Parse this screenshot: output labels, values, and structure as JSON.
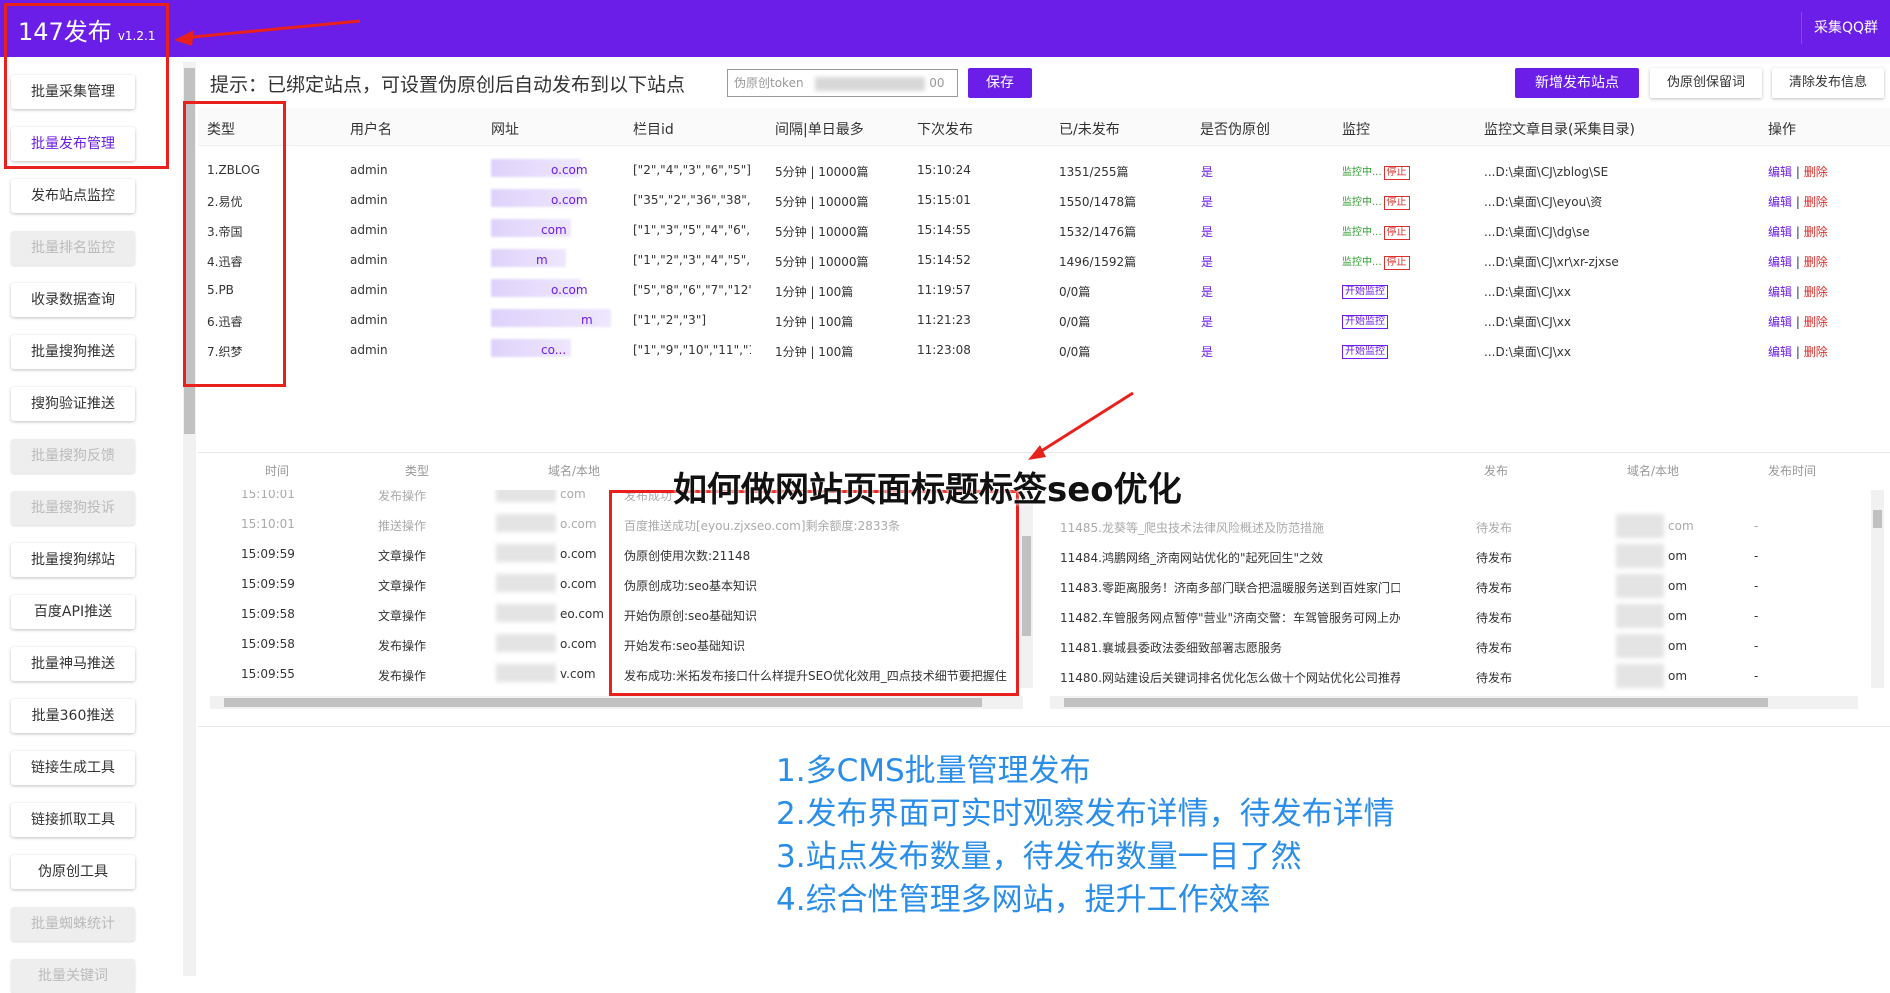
{
  "app": {
    "title": "147发布",
    "version": "v1.2.1",
    "qq_button": "采集QQ群"
  },
  "sidebar": {
    "items": [
      {
        "label": "批量采集管理",
        "state": "normal"
      },
      {
        "label": "批量发布管理",
        "state": "active"
      },
      {
        "label": "发布站点监控",
        "state": "normal"
      },
      {
        "label": "批量排名监控",
        "state": "disabled"
      },
      {
        "label": "收录数据查询",
        "state": "normal"
      },
      {
        "label": "批量搜狗推送",
        "state": "normal"
      },
      {
        "label": "搜狗验证推送",
        "state": "normal"
      },
      {
        "label": "批量搜狗反馈",
        "state": "disabled"
      },
      {
        "label": "批量搜狗投诉",
        "state": "disabled"
      },
      {
        "label": "批量搜狗绑站",
        "state": "normal"
      },
      {
        "label": "百度API推送",
        "state": "normal"
      },
      {
        "label": "批量神马推送",
        "state": "normal"
      },
      {
        "label": "批量360推送",
        "state": "normal"
      },
      {
        "label": "链接生成工具",
        "state": "normal"
      },
      {
        "label": "链接抓取工具",
        "state": "normal"
      },
      {
        "label": "伪原创工具",
        "state": "normal"
      },
      {
        "label": "批量蜘蛛统计",
        "state": "disabled"
      },
      {
        "label": "批量关键词",
        "state": "disabled"
      }
    ]
  },
  "header": {
    "hint": "提示：已绑定站点，可设置伪原创后自动发布到以下站点",
    "token_placeholder": "伪原创token",
    "token_value_tail": "00",
    "save_label": "保存",
    "add_site_label": "新增发布站点",
    "keep_words_label": "伪原创保留词",
    "clear_label": "清除发布信息"
  },
  "table": {
    "columns": [
      "类型",
      "用户名",
      "网址",
      "栏目id",
      "间隔|单日最多",
      "下次发布",
      "已/未发布",
      "是否伪原创",
      "监控",
      "监控文章目录(采集目录)",
      "操作"
    ],
    "rows": [
      {
        "type": "1.ZBLOG",
        "user": "admin",
        "url": "o.com",
        "cat": "[\"2\",\"4\",\"3\",\"6\",\"5\"]",
        "interval": "5分钟 | 10000篇",
        "next": "15:10:24",
        "count": "1351/255篇",
        "pseudo": "是",
        "monitor": "监控中...",
        "monitor_action": "停止",
        "monitoring": true,
        "dir": "...D:\\桌面\\CJ\\zblog\\SE",
        "edit": "编辑",
        "del": "删除"
      },
      {
        "type": "2.易优",
        "user": "admin",
        "url": "o.com",
        "cat": "[\"35\",\"2\",\"36\",\"38\",\"...",
        "interval": "5分钟 | 10000篇",
        "next": "15:15:01",
        "count": "1550/1478篇",
        "pseudo": "是",
        "monitor": "监控中...",
        "monitor_action": "停止",
        "monitoring": true,
        "dir": "...D:\\桌面\\CJ\\eyou\\资",
        "edit": "编辑",
        "del": "删除"
      },
      {
        "type": "3.帝国",
        "user": "admin",
        "url": "com",
        "cat": "[\"1\",\"3\",\"5\",\"4\",\"6\",\"7\"]",
        "interval": "5分钟 | 10000篇",
        "next": "15:14:55",
        "count": "1532/1476篇",
        "pseudo": "是",
        "monitor": "监控中...",
        "monitor_action": "停止",
        "monitoring": true,
        "dir": "...D:\\桌面\\CJ\\dg\\se",
        "edit": "编辑",
        "del": "删除"
      },
      {
        "type": "4.迅睿",
        "user": "admin",
        "url": "m",
        "cat": "[\"1\",\"2\",\"3\",\"4\",\"5\",\"8\"]",
        "interval": "5分钟 | 10000篇",
        "next": "15:14:52",
        "count": "1496/1592篇",
        "pseudo": "是",
        "monitor": "监控中...",
        "monitor_action": "停止",
        "monitoring": true,
        "dir": "...D:\\桌面\\CJ\\xr\\xr-zjxse",
        "edit": "编辑",
        "del": "删除"
      },
      {
        "type": "5.PB",
        "user": "admin",
        "url": "o.com",
        "cat": "[\"5\",\"8\",\"6\",\"7\",\"12\",...",
        "interval": "1分钟 | 100篇",
        "next": "11:19:57",
        "count": "0/0篇",
        "pseudo": "是",
        "monitor": "",
        "monitor_action": "开始监控",
        "monitoring": false,
        "dir": "...D:\\桌面\\CJ\\xx",
        "edit": "编辑",
        "del": "删除"
      },
      {
        "type": "6.迅睿",
        "user": "admin",
        "url": "m",
        "cat": "[\"1\",\"2\",\"3\"]",
        "interval": "1分钟 | 100篇",
        "next": "11:21:23",
        "count": "0/0篇",
        "pseudo": "是",
        "monitor": "",
        "monitor_action": "开始监控",
        "monitoring": false,
        "dir": "...D:\\桌面\\CJ\\xx",
        "edit": "编辑",
        "del": "删除"
      },
      {
        "type": "7.织梦",
        "user": "admin",
        "url": "co...",
        "cat": "[\"1\",\"9\",\"10\",\"11\",\"1...",
        "interval": "1分钟 | 100篇",
        "next": "11:23:08",
        "count": "0/0篇",
        "pseudo": "是",
        "monitor": "",
        "monitor_action": "开始监控",
        "monitoring": false,
        "dir": "...D:\\桌面\\CJ\\xx",
        "edit": "编辑",
        "del": "删除"
      }
    ]
  },
  "log_left": {
    "columns": [
      "时间",
      "类型",
      "域名/本地"
    ],
    "rows": [
      {
        "time": "15:10:01",
        "type": "发布操作",
        "domain": "com",
        "msg": "发布成功",
        "faded": true
      },
      {
        "time": "15:10:01",
        "type": "推送操作",
        "domain": "o.com",
        "msg": "百度推送成功[eyou.zjxseo.com]剩余额度:2833条",
        "faded": true
      },
      {
        "time": "15:09:59",
        "type": "文章操作",
        "domain": "o.com",
        "msg": "伪原创使用次数:21148",
        "faded": false
      },
      {
        "time": "15:09:59",
        "type": "文章操作",
        "domain": "o.com",
        "msg": "伪原创成功:seo基本知识",
        "faded": false
      },
      {
        "time": "15:09:58",
        "type": "文章操作",
        "domain": "eo.com",
        "msg": "开始伪原创:seo基础知识",
        "faded": false
      },
      {
        "time": "15:09:58",
        "type": "发布操作",
        "domain": "o.com",
        "msg": "开始发布:seo基础知识",
        "faded": false
      },
      {
        "time": "15:09:55",
        "type": "发布操作",
        "domain": "v.com",
        "msg": "发布成功:米拓发布接口什么样提升SEO优化效用_四点技术细节要把握住",
        "faded": false
      }
    ]
  },
  "log_right": {
    "columns": [
      "发布",
      "域名/本地",
      "发布时间"
    ],
    "rows": [
      {
        "title": "11485.龙葵等_爬虫技术法律风险概述及防范措施",
        "status": "待发布",
        "domain": "com",
        "time": "-",
        "faded": true
      },
      {
        "title": "11484.鸿鹏网络_济南网站优化的\"起死回生\"之效",
        "status": "待发布",
        "domain": "om",
        "time": "-",
        "faded": false
      },
      {
        "title": "11483.零距离服务！济南多部门联合把温暖服务送到百姓家门口",
        "status": "待发布",
        "domain": "om",
        "time": "-",
        "faded": false
      },
      {
        "title": "11482.车管服务网点暂停\"营业\"济南交警：车驾管服务可网上办",
        "status": "待发布",
        "domain": "om",
        "time": "-",
        "faded": false
      },
      {
        "title": "11481.襄城县委政法委细致部署志愿服务",
        "status": "待发布",
        "domain": "om",
        "time": "-",
        "faded": false
      },
      {
        "title": "11480.网站建设后关键词排名优化怎么做十个网站优化公司推荐",
        "status": "待发布",
        "domain": "om",
        "time": "-",
        "faded": false
      }
    ]
  },
  "overlay": {
    "watermark": "如何做网站页面标题标签seo优化",
    "features": [
      "1.多CMS批量管理发布",
      "2.发布界面可实时观察发布详情，待发布详情",
      "3.站点发布数量，待发布数量一目了然",
      "4.综合性管理多网站，提升工作效率"
    ]
  },
  "colors": {
    "brand": "#6a1ee8",
    "annotation_red": "#e8211d",
    "feature_blue": "#2a8ee8",
    "stop_red": "#d9302c",
    "monitor_green": "#2e9b2e"
  }
}
